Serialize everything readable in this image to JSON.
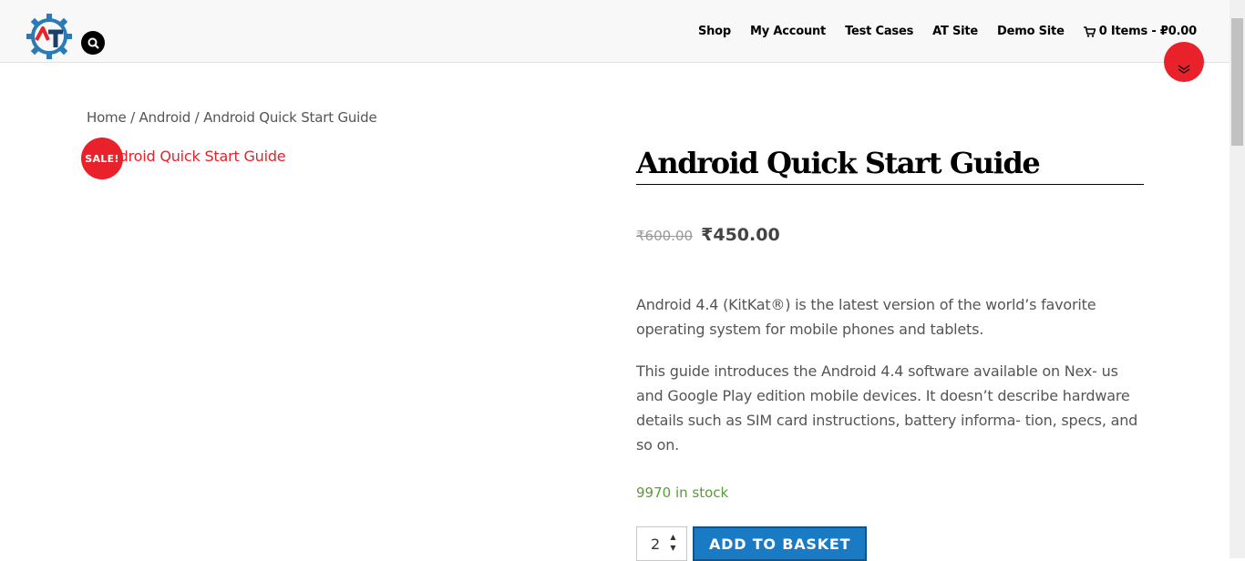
{
  "header": {
    "nav": [
      {
        "label": "Shop"
      },
      {
        "label": "My Account"
      },
      {
        "label": "Test Cases"
      },
      {
        "label": "AT Site"
      },
      {
        "label": "Demo Site"
      }
    ],
    "cart_label": "0 Items - ₽0.00"
  },
  "breadcrumb": {
    "home": "Home",
    "sep1": " / ",
    "category": "Android",
    "sep2": " / ",
    "current": "Android Quick Start Guide"
  },
  "product": {
    "image_alt": "Android Quick Start Guide",
    "sale_badge": "SALE!",
    "title": "Android Quick Start Guide",
    "old_price": "₹600.00",
    "new_price": "₹450.00",
    "description": [
      "Android 4.4 (KitKat®) is the latest version of the world’s favorite operating system for mobile phones and tablets.",
      "This guide introduces the Android 4.4 software available on Nex- us and Google Play edition mobile devices. It doesn’t describe hardware details such as SIM card instructions, battery informa- tion, specs, and so on."
    ],
    "stock": "9970 in stock",
    "quantity": "2",
    "add_button": "ADD TO BASKET"
  },
  "colors": {
    "accent_red": "#e8212a",
    "button_blue": "#1a7bc4",
    "stock_green": "#5b9a3a"
  }
}
